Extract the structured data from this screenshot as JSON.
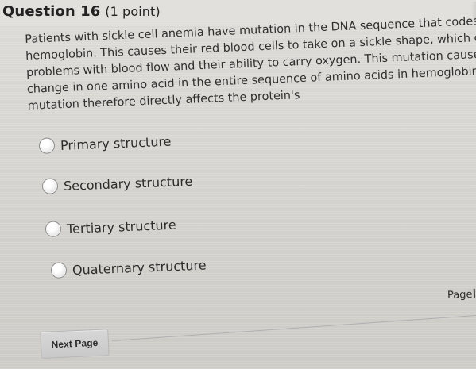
{
  "question": {
    "title": "Question 16",
    "points": "(1 point)"
  },
  "prompt_lines": [
    "Patients with sickle cell anemia have mutation in the DNA sequence that codes for",
    "hemoglobin. This causes their red blood cells to take on a sickle shape, which causes",
    "problems with blood flow and their ability to carry oxygen. This mutation causes a",
    "change in one amino acid in the entire sequence of amino acids in hemoglobin. This",
    "mutation therefore directly affects the protein's"
  ],
  "answers": [
    {
      "label": "Primary structure"
    },
    {
      "label": "Secondary structure"
    },
    {
      "label": "Tertiary structure"
    },
    {
      "label": "Quaternary structure"
    }
  ],
  "next_button": {
    "label": "Next Page"
  },
  "page_label": "Page"
}
